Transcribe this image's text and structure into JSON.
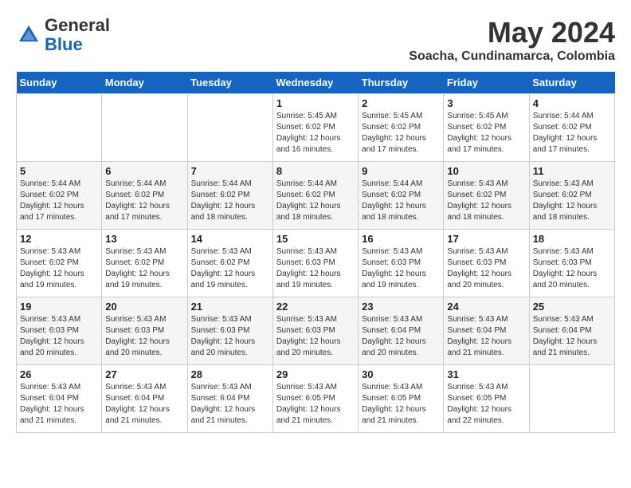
{
  "header": {
    "logo": {
      "general": "General",
      "blue": "Blue"
    },
    "month": "May 2024",
    "location": "Soacha, Cundinamarca, Colombia"
  },
  "weekdays": [
    "Sunday",
    "Monday",
    "Tuesday",
    "Wednesday",
    "Thursday",
    "Friday",
    "Saturday"
  ],
  "weeks": [
    [
      {
        "day": "",
        "info": ""
      },
      {
        "day": "",
        "info": ""
      },
      {
        "day": "",
        "info": ""
      },
      {
        "day": "1",
        "info": "Sunrise: 5:45 AM\nSunset: 6:02 PM\nDaylight: 12 hours\nand 16 minutes."
      },
      {
        "day": "2",
        "info": "Sunrise: 5:45 AM\nSunset: 6:02 PM\nDaylight: 12 hours\nand 17 minutes."
      },
      {
        "day": "3",
        "info": "Sunrise: 5:45 AM\nSunset: 6:02 PM\nDaylight: 12 hours\nand 17 minutes."
      },
      {
        "day": "4",
        "info": "Sunrise: 5:44 AM\nSunset: 6:02 PM\nDaylight: 12 hours\nand 17 minutes."
      }
    ],
    [
      {
        "day": "5",
        "info": "Sunrise: 5:44 AM\nSunset: 6:02 PM\nDaylight: 12 hours\nand 17 minutes."
      },
      {
        "day": "6",
        "info": "Sunrise: 5:44 AM\nSunset: 6:02 PM\nDaylight: 12 hours\nand 17 minutes."
      },
      {
        "day": "7",
        "info": "Sunrise: 5:44 AM\nSunset: 6:02 PM\nDaylight: 12 hours\nand 18 minutes."
      },
      {
        "day": "8",
        "info": "Sunrise: 5:44 AM\nSunset: 6:02 PM\nDaylight: 12 hours\nand 18 minutes."
      },
      {
        "day": "9",
        "info": "Sunrise: 5:44 AM\nSunset: 6:02 PM\nDaylight: 12 hours\nand 18 minutes."
      },
      {
        "day": "10",
        "info": "Sunrise: 5:43 AM\nSunset: 6:02 PM\nDaylight: 12 hours\nand 18 minutes."
      },
      {
        "day": "11",
        "info": "Sunrise: 5:43 AM\nSunset: 6:02 PM\nDaylight: 12 hours\nand 18 minutes."
      }
    ],
    [
      {
        "day": "12",
        "info": "Sunrise: 5:43 AM\nSunset: 6:02 PM\nDaylight: 12 hours\nand 19 minutes."
      },
      {
        "day": "13",
        "info": "Sunrise: 5:43 AM\nSunset: 6:02 PM\nDaylight: 12 hours\nand 19 minutes."
      },
      {
        "day": "14",
        "info": "Sunrise: 5:43 AM\nSunset: 6:02 PM\nDaylight: 12 hours\nand 19 minutes."
      },
      {
        "day": "15",
        "info": "Sunrise: 5:43 AM\nSunset: 6:03 PM\nDaylight: 12 hours\nand 19 minutes."
      },
      {
        "day": "16",
        "info": "Sunrise: 5:43 AM\nSunset: 6:03 PM\nDaylight: 12 hours\nand 19 minutes."
      },
      {
        "day": "17",
        "info": "Sunrise: 5:43 AM\nSunset: 6:03 PM\nDaylight: 12 hours\nand 20 minutes."
      },
      {
        "day": "18",
        "info": "Sunrise: 5:43 AM\nSunset: 6:03 PM\nDaylight: 12 hours\nand 20 minutes."
      }
    ],
    [
      {
        "day": "19",
        "info": "Sunrise: 5:43 AM\nSunset: 6:03 PM\nDaylight: 12 hours\nand 20 minutes."
      },
      {
        "day": "20",
        "info": "Sunrise: 5:43 AM\nSunset: 6:03 PM\nDaylight: 12 hours\nand 20 minutes."
      },
      {
        "day": "21",
        "info": "Sunrise: 5:43 AM\nSunset: 6:03 PM\nDaylight: 12 hours\nand 20 minutes."
      },
      {
        "day": "22",
        "info": "Sunrise: 5:43 AM\nSunset: 6:03 PM\nDaylight: 12 hours\nand 20 minutes."
      },
      {
        "day": "23",
        "info": "Sunrise: 5:43 AM\nSunset: 6:04 PM\nDaylight: 12 hours\nand 20 minutes."
      },
      {
        "day": "24",
        "info": "Sunrise: 5:43 AM\nSunset: 6:04 PM\nDaylight: 12 hours\nand 21 minutes."
      },
      {
        "day": "25",
        "info": "Sunrise: 5:43 AM\nSunset: 6:04 PM\nDaylight: 12 hours\nand 21 minutes."
      }
    ],
    [
      {
        "day": "26",
        "info": "Sunrise: 5:43 AM\nSunset: 6:04 PM\nDaylight: 12 hours\nand 21 minutes."
      },
      {
        "day": "27",
        "info": "Sunrise: 5:43 AM\nSunset: 6:04 PM\nDaylight: 12 hours\nand 21 minutes."
      },
      {
        "day": "28",
        "info": "Sunrise: 5:43 AM\nSunset: 6:04 PM\nDaylight: 12 hours\nand 21 minutes."
      },
      {
        "day": "29",
        "info": "Sunrise: 5:43 AM\nSunset: 6:05 PM\nDaylight: 12 hours\nand 21 minutes."
      },
      {
        "day": "30",
        "info": "Sunrise: 5:43 AM\nSunset: 6:05 PM\nDaylight: 12 hours\nand 21 minutes."
      },
      {
        "day": "31",
        "info": "Sunrise: 5:43 AM\nSunset: 6:05 PM\nDaylight: 12 hours\nand 22 minutes."
      },
      {
        "day": "",
        "info": ""
      }
    ]
  ]
}
